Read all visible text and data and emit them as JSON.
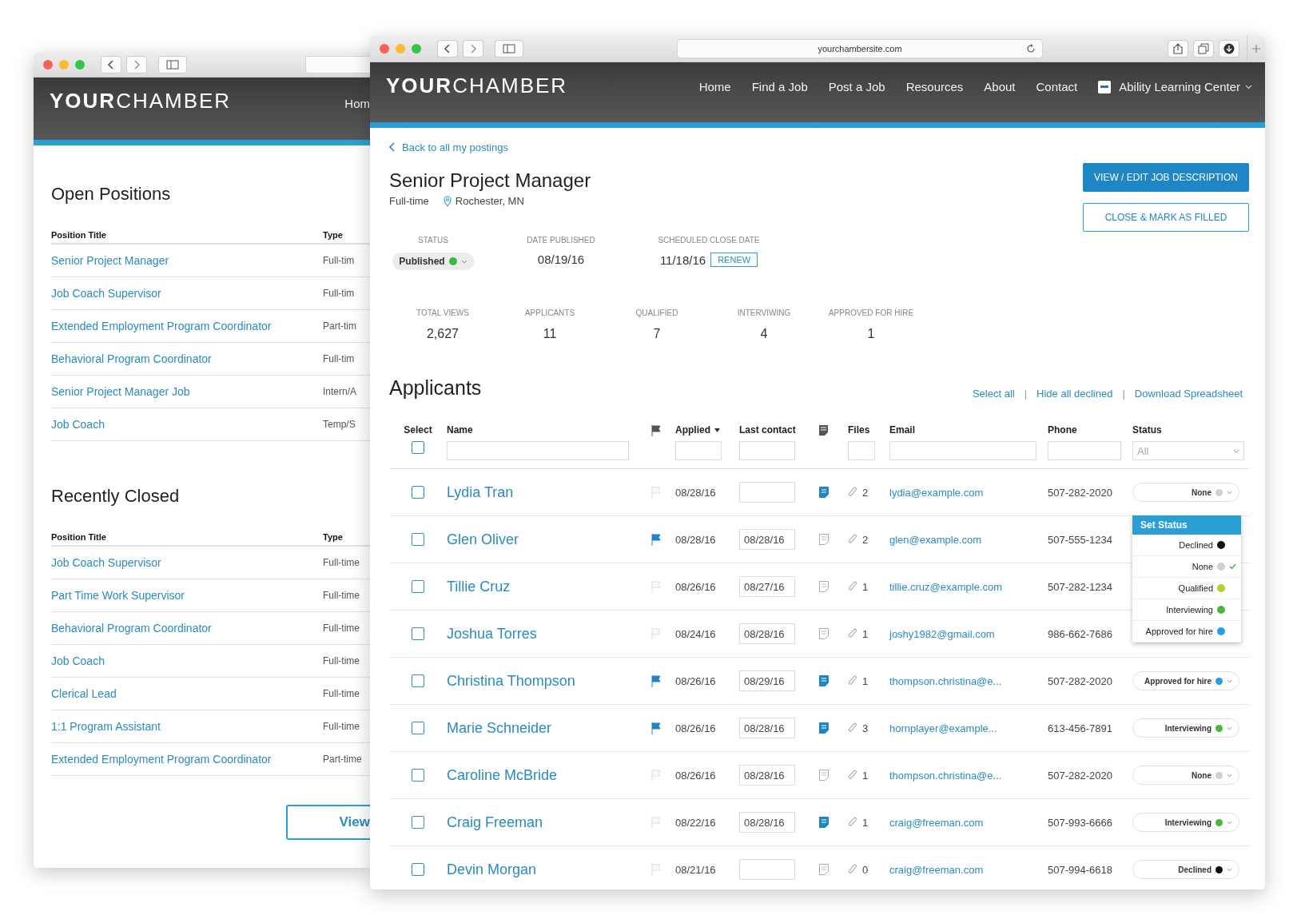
{
  "back_window": {
    "logo": {
      "bold": "YOUR",
      "light": "CHAMBER"
    },
    "nav": [
      "Hom"
    ],
    "sections": [
      {
        "title": "Open Positions",
        "columns": [
          "Position Title",
          "Type"
        ],
        "rows": [
          {
            "title": "Senior Project Manager",
            "type": "Full-tim"
          },
          {
            "title": "Job Coach Supervisor",
            "type": "Full-tim"
          },
          {
            "title": "Extended Employment Program Coordinator",
            "type": "Part-tim"
          },
          {
            "title": "Behavioral Program Coordinator",
            "type": "Full-tim"
          },
          {
            "title": "Senior Project Manager Job",
            "type": "Intern/A"
          },
          {
            "title": "Job Coach",
            "type": "Temp/S"
          }
        ]
      },
      {
        "title": "Recently Closed",
        "columns": [
          "Position Title",
          "Type"
        ],
        "rows": [
          {
            "title": "Job Coach Supervisor",
            "type": "Full-time"
          },
          {
            "title": "Part Time Work Supervisor",
            "type": "Full-time"
          },
          {
            "title": "Behavioral Program Coordinator",
            "type": "Full-time"
          },
          {
            "title": "Job Coach",
            "type": "Full-time"
          },
          {
            "title": "Clerical Lead",
            "type": "Full-time"
          },
          {
            "title": "1:1 Program Assistant",
            "type": "Full-time"
          },
          {
            "title": "Extended Employment Program Coordinator",
            "type": "Part-time"
          }
        ]
      }
    ],
    "button": "View"
  },
  "front_window": {
    "url": "yourchambersite.com",
    "logo": {
      "bold": "YOUR",
      "light": "CHAMBER"
    },
    "nav": [
      "Home",
      "Find a Job",
      "Post a Job",
      "Resources",
      "About",
      "Contact"
    ],
    "account": "Ability Learning Center",
    "back_link": "Back to all my postings",
    "job": {
      "title": "Senior Project Manager",
      "type": "Full-time",
      "location": "Rochester, MN"
    },
    "buttons": [
      {
        "label": "VIEW / EDIT JOB DESCRIPTION",
        "kind": "primary"
      },
      {
        "label": "CLOSE & MARK AS FILLED",
        "kind": "outline"
      }
    ],
    "details": [
      {
        "label": "STATUS",
        "kind": "status",
        "value": "Published",
        "color": "#3cb84a"
      },
      {
        "label": "DATE PUBLISHED",
        "kind": "text",
        "value": "08/19/16"
      },
      {
        "label": "SCHEDULED CLOSE DATE",
        "kind": "renew",
        "value": "11/18/16",
        "action": "RENEW"
      }
    ],
    "stats": [
      {
        "label": "TOTAL VIEWS",
        "value": "2,627"
      },
      {
        "label": "APPLICANTS",
        "value": "11"
      },
      {
        "label": "QUALIFIED",
        "value": "7"
      },
      {
        "label": "INTERVIWING",
        "value": "4"
      },
      {
        "label": "APPROVED FOR HIRE",
        "value": "1"
      }
    ],
    "applicants": {
      "title": "Applicants",
      "actions": [
        "Select all",
        "Hide all declined",
        "Download Spreadsheet"
      ],
      "separators": [
        "|",
        "|"
      ],
      "select_all_checked": false,
      "columns": {
        "select": "Select",
        "name": "Name",
        "applied": "Applied",
        "applied_sorted": true,
        "last_contact": "Last contact",
        "files": "Files",
        "email": "Email",
        "phone": "Phone",
        "status": "Status"
      },
      "status_filter": "All",
      "rows": [
        {
          "checked": false,
          "name": "Lydia Tran",
          "flagged": false,
          "applied": "08/28/16",
          "notes": true,
          "files": "2",
          "email": "lydia@example.com",
          "phone": "507-282-2020",
          "status": {
            "label": "None",
            "color": "#d0d0d0"
          }
        },
        {
          "checked": false,
          "name": "Glen Oliver",
          "flagged": true,
          "applied": "08/28/16",
          "last_contact": "08/28/16",
          "notes": false,
          "files": "2",
          "email": "glen@example.com",
          "phone": "507-555-1234"
        },
        {
          "checked": false,
          "name": "Tillie Cruz",
          "flagged": false,
          "applied": "08/26/16",
          "last_contact": "08/27/16",
          "notes": false,
          "files": "1",
          "email": "tillie.cruz@example.com",
          "phone": "507-282-1234"
        },
        {
          "checked": false,
          "name": "Joshua Torres",
          "flagged": false,
          "applied": "08/24/16",
          "last_contact": "08/28/16",
          "notes": false,
          "files": "1",
          "email": "joshy1982@gmail.com",
          "phone": "986-662-7686"
        },
        {
          "checked": false,
          "name": "Christina Thompson",
          "flagged": true,
          "applied": "08/26/16",
          "last_contact": "08/29/16",
          "notes": true,
          "files": "1",
          "email": "thompson.christina@e...",
          "phone": "507-282-2020",
          "status": {
            "label": "Approved for hire",
            "color": "#2a9fe0"
          }
        },
        {
          "checked": false,
          "name": "Marie Schneider",
          "flagged": true,
          "applied": "08/26/16",
          "last_contact": "08/28/16",
          "notes": true,
          "files": "3",
          "email": "hornplayer@example...",
          "phone": "613-456-7891",
          "status": {
            "label": "Interviewing",
            "color": "#46b83c"
          }
        },
        {
          "checked": false,
          "name": "Caroline McBride",
          "flagged": false,
          "applied": "08/26/16",
          "last_contact": "08/28/16",
          "notes": false,
          "files": "1",
          "email": "thompson.christina@e...",
          "phone": "507-282-2020",
          "status": {
            "label": "None",
            "color": "#d0d0d0"
          }
        },
        {
          "checked": false,
          "name": "Craig Freeman",
          "flagged": false,
          "applied": "08/22/16",
          "last_contact": "08/28/16",
          "notes": true,
          "files": "1",
          "email": "craig@freeman.com",
          "phone": "507-993-6666",
          "status": {
            "label": "Interviewing",
            "color": "#46b83c"
          }
        },
        {
          "checked": false,
          "name": "Devin Morgan",
          "flagged": false,
          "applied": "08/21/16",
          "notes": false,
          "files": "0",
          "email": "craig@freeman.com",
          "phone": "507-994-6618",
          "status": {
            "label": "Declined",
            "color": "#111111"
          }
        }
      ],
      "status_menu": {
        "title": "Set Status",
        "options": [
          {
            "label": "Declined",
            "color": "#111111",
            "selected": false
          },
          {
            "label": "None",
            "color": "#d0d0d0",
            "selected": true
          },
          {
            "label": "Qualified",
            "color": "#b8cf2a",
            "selected": false
          },
          {
            "label": "Interviewing",
            "color": "#46b83c",
            "selected": false
          },
          {
            "label": "Approved for hire",
            "color": "#2a9fe0",
            "selected": false
          }
        ]
      }
    }
  }
}
